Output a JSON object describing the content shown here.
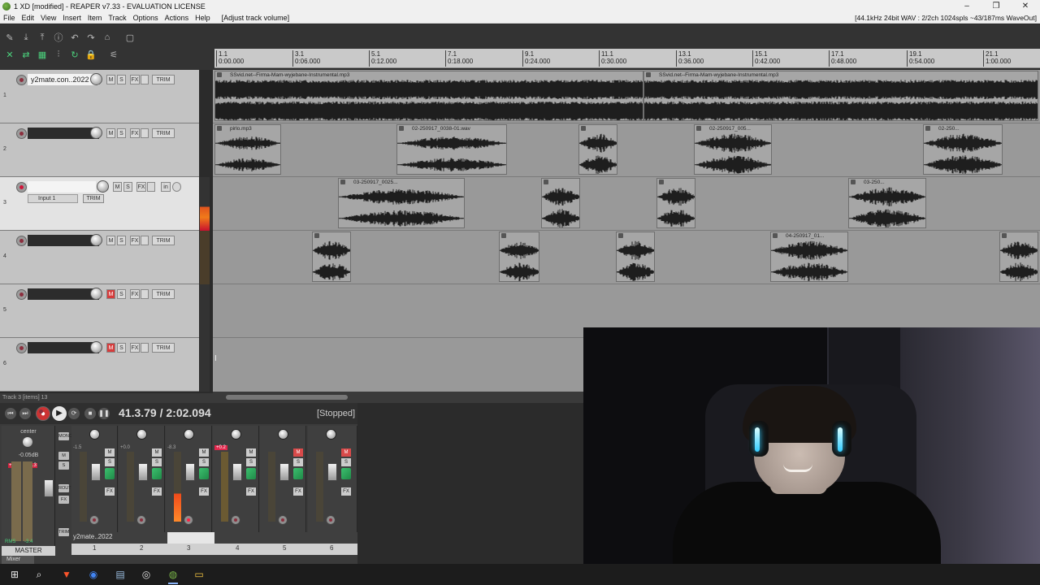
{
  "window": {
    "title": "1 XD [modified] - REAPER v7.33 - EVALUATION LICENSE",
    "controls": [
      "–",
      "❐",
      "✕"
    ]
  },
  "menu": {
    "items": [
      "File",
      "Edit",
      "View",
      "Insert",
      "Item",
      "Track",
      "Options",
      "Actions",
      "Help"
    ],
    "last_action": "[Adjust track volume]",
    "audio_status": "[44.1kHz 24bit WAV : 2/2ch 1024spls ~43/187ms WaveOut]"
  },
  "toolbar": {
    "row1": [
      "✎",
      "⤓",
      "⤒",
      "ⓘ",
      "↶",
      "↷",
      "⌂",
      "▢"
    ],
    "row2": [
      "✕",
      "⇄",
      "▦",
      "⫶",
      "↻",
      "🔒",
      "⚟"
    ]
  },
  "ruler": {
    "ticks": [
      {
        "bar": "1.1",
        "time": "0:00.000"
      },
      {
        "bar": "3.1",
        "time": "0:06.000"
      },
      {
        "bar": "5.1",
        "time": "0:12.000"
      },
      {
        "bar": "7.1",
        "time": "0:18.000"
      },
      {
        "bar": "9.1",
        "time": "0:24.000"
      },
      {
        "bar": "11.1",
        "time": "0:30.000"
      },
      {
        "bar": "13.1",
        "time": "0:36.000"
      },
      {
        "bar": "15.1",
        "time": "0:42.000"
      },
      {
        "bar": "17.1",
        "time": "0:48.000"
      },
      {
        "bar": "19.1",
        "time": "0:54.000"
      },
      {
        "bar": "21.1",
        "time": "1:00.000"
      }
    ]
  },
  "tracks": [
    {
      "number": "1",
      "name": "y2mate.con..2022",
      "mute_on": false,
      "armed": false
    },
    {
      "number": "2",
      "name": "",
      "mute_on": false,
      "armed": false
    },
    {
      "number": "3",
      "name": "",
      "mute_on": false,
      "armed": true,
      "input": "Input 1",
      "io_label": "in"
    },
    {
      "number": "4",
      "name": "",
      "mute_on": false,
      "armed": false
    },
    {
      "number": "5",
      "name": "",
      "mute_on": true,
      "armed": false
    },
    {
      "number": "6",
      "name": "",
      "mute_on": true,
      "armed": false
    }
  ],
  "tcp_labels": {
    "mute": "M",
    "solo": "S",
    "fx": "FX",
    "trim": "TRIM"
  },
  "items": {
    "lane1": [
      {
        "title": "SSvid.net--Firma-Mam-wyjebane-Instrumental.mp3"
      },
      {
        "title": "SSvid.net--Firma-Mam-wyjebane-Instrumental.mp3"
      }
    ],
    "lane2": [
      {
        "title": "pirlo.mp3"
      },
      {
        "title": "02-250917_0038-01.wav"
      },
      {
        "title": ""
      },
      {
        "title": "02-250917_005..."
      },
      {
        "title": "02-250..."
      }
    ],
    "lane3": [
      {
        "title": "03-250917_0025..."
      },
      {
        "title": ""
      },
      {
        "title": ""
      },
      {
        "title": "03-250..."
      }
    ],
    "lane4": [
      {
        "title": ""
      },
      {
        "title": ""
      },
      {
        "title": ""
      },
      {
        "title": "04-250917_01..."
      },
      {
        "title": ""
      }
    ]
  },
  "status_line": "Track 3 [items] 13",
  "transport": {
    "time": "41.3.79 / 2:02.094",
    "state": "[Stopped]"
  },
  "mixer": {
    "master": {
      "pan_label": "center",
      "volume_db": "-0.05dB",
      "peak_left": "+3.3",
      "peak_right": "+1.3",
      "rms_label": "RMS",
      "rms_value": "-3.4",
      "label": "MASTER",
      "side_buttons": [
        "MONO",
        "M",
        "S",
        "ROUTE",
        "FX",
        "TRIM"
      ]
    },
    "strips": [
      {
        "number": "1",
        "vol": "-1.5",
        "hot": false,
        "mute_on": false,
        "armed": false
      },
      {
        "number": "2",
        "vol": "+0.0",
        "hot": false,
        "mute_on": false,
        "armed": false
      },
      {
        "number": "3",
        "vol": "-8.3",
        "hot": false,
        "mute_on": false,
        "armed": true
      },
      {
        "number": "4",
        "vol": "+0.2",
        "hot": true,
        "mute_on": false,
        "armed": false
      },
      {
        "number": "5",
        "vol": "",
        "hot": false,
        "mute_on": true,
        "armed": false
      },
      {
        "number": "6",
        "vol": "",
        "hot": false,
        "mute_on": true,
        "armed": false
      }
    ],
    "first_name": "y2mate..2022",
    "tab_label": "Mixer"
  },
  "taskbar": {
    "icons": [
      "windows-icon",
      "search-icon",
      "brave-icon",
      "chrome-icon",
      "notepad-icon",
      "obs-icon",
      "reaper-icon",
      "explorer-icon"
    ]
  },
  "colors": {
    "accent_green": "#4bd17c",
    "mute_red": "#d63c3c",
    "arm_red": "#d0153a",
    "meter_orange": "#f04a1a"
  }
}
